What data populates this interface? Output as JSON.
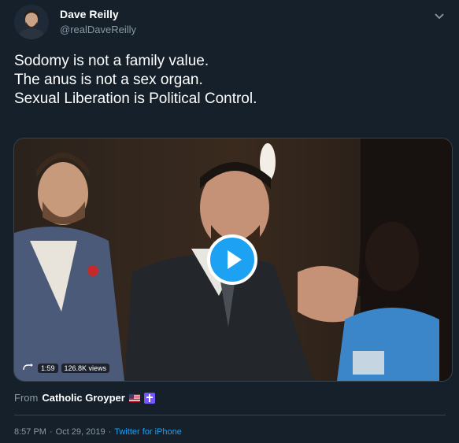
{
  "author": {
    "name": "Dave Reilly",
    "handle": "@realDaveReilly"
  },
  "tweet": {
    "lines": [
      "Sodomy is not a family value.",
      "The anus is not a sex organ.",
      "Sexual Liberation is Political Control."
    ]
  },
  "video": {
    "duration": "1:59",
    "views": "126.8K views"
  },
  "attribution": {
    "prefix": "From",
    "account": "Catholic Groyper"
  },
  "meta": {
    "time": "8:57 PM",
    "separator": "·",
    "date": "Oct 29, 2019",
    "source": "Twitter for iPhone"
  },
  "colors": {
    "background": "#15202b",
    "accent": "#1da1f2",
    "muted": "#8899a6",
    "border": "#38444d"
  },
  "icons": [
    "chevron-down-icon",
    "play-icon",
    "loop-icon",
    "us-flag-icon",
    "cross-icon"
  ]
}
